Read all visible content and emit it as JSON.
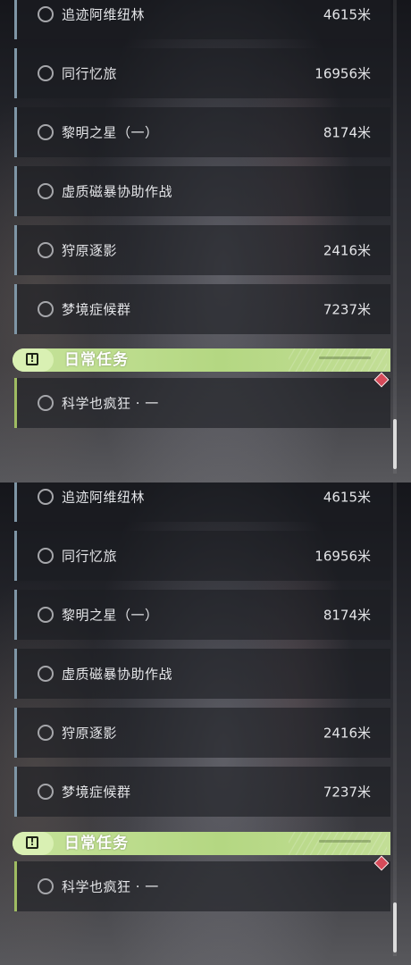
{
  "quest_list": {
    "main_quests": [
      {
        "title": "追迹阿维纽林",
        "distance": "4615米"
      },
      {
        "title": "同行忆旅",
        "distance": "16956米"
      },
      {
        "title": "黎明之星（一）",
        "distance": "8174米"
      },
      {
        "title": "虚质磁暴协助作战",
        "distance": ""
      },
      {
        "title": "狩原逐影",
        "distance": "2416米"
      },
      {
        "title": "梦境症候群",
        "distance": "7237米"
      }
    ],
    "daily_section": {
      "icon": "alert-box-icon",
      "title": "日常任务"
    },
    "daily_quests": [
      {
        "title": "科学也疯狂 · 一",
        "distance": ""
      }
    ]
  },
  "colors": {
    "quest_accent": "#7f96a6",
    "daily_accent": "#9fbc62",
    "daily_header": "#c0df90",
    "marker": "#d64b5a"
  }
}
